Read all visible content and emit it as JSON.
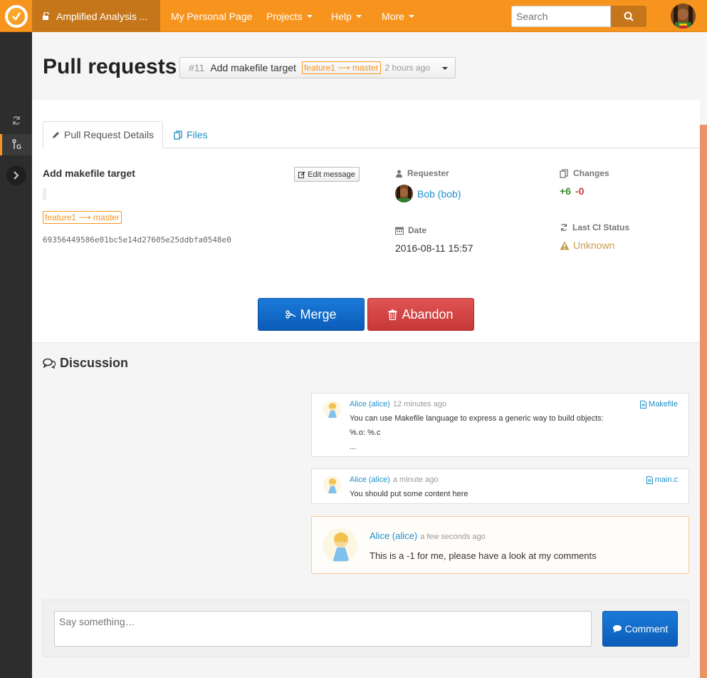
{
  "topbar": {
    "logo_icon": "openproject-logo-icon",
    "project_name": "Amplified Analysis ...",
    "nav": [
      {
        "label": "My Personal Page",
        "dropdown": false
      },
      {
        "label": "Projects",
        "dropdown": true
      },
      {
        "label": "Help",
        "dropdown": true
      },
      {
        "label": "More",
        "dropdown": true
      }
    ],
    "search_placeholder": "Search",
    "accent_color": "#f7941d"
  },
  "sidebar": {
    "icons": [
      "refresh-icon",
      "pull-request-icon",
      "expand-icon"
    ]
  },
  "header": {
    "title": "Pull requests",
    "pr_selector": {
      "number": "#11",
      "title": "Add makefile target",
      "branch": "feature1 ⟶ master",
      "time": "2 hours ago"
    }
  },
  "tabs": [
    {
      "label": "Pull Request Details",
      "active": true
    },
    {
      "label": "Files",
      "active": false
    }
  ],
  "details": {
    "message_title": "Add makefile target",
    "edit_label": "Edit message",
    "branch": "feature1 ⟶ master",
    "hash": "69356449586e01bc5e14d27605e25ddbfa0548e0",
    "requester_label": "Requester",
    "requester": "Bob (bob)",
    "date_label": "Date",
    "date": "2016-08-11 15:57",
    "changes_label": "Changes",
    "additions": "+6",
    "deletions": "-0",
    "ci_label": "Last CI Status",
    "ci_status": "Unknown"
  },
  "actions": {
    "merge": "Merge",
    "abandon": "Abandon"
  },
  "discussion": {
    "title": "Discussion",
    "comments": [
      {
        "author": "Alice (alice)",
        "time": "12 minutes ago",
        "file": "Makefile",
        "lines": [
          "You can use Makefile language to express a generic way to build objects:",
          "%.o: %.c",
          "..."
        ]
      },
      {
        "author": "Alice (alice)",
        "time": "a minute ago",
        "file": "main.c",
        "lines": [
          "You should put some content here"
        ]
      },
      {
        "author": "Alice (alice)",
        "time": "a few seconds ago",
        "lines": [
          "This is a -1 for me, please have a look at my comments"
        ]
      }
    ],
    "input_placeholder": "Say something…",
    "comment_button": "Comment"
  }
}
